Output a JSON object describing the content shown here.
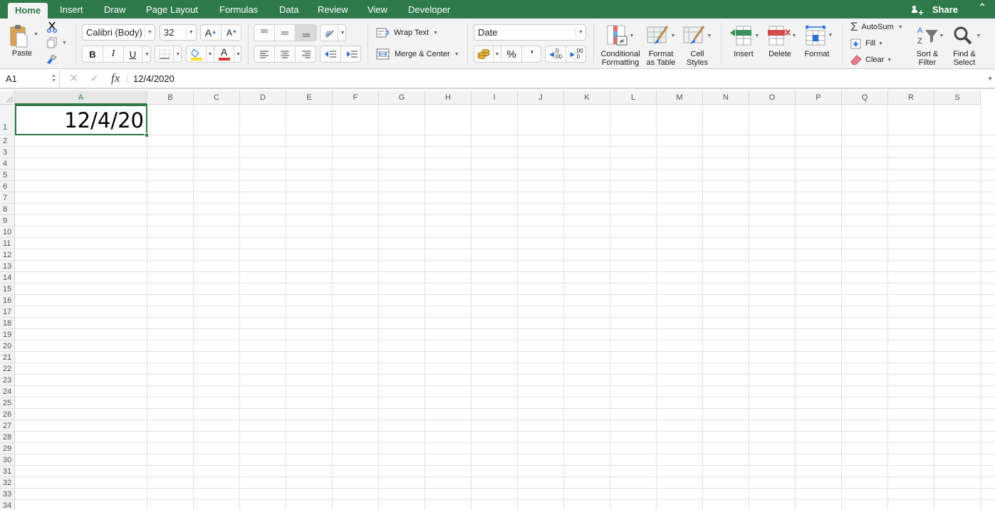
{
  "ribbon_tabs": [
    {
      "label": "Home",
      "active": true
    },
    {
      "label": "Insert"
    },
    {
      "label": "Draw"
    },
    {
      "label": "Page Layout"
    },
    {
      "label": "Formulas"
    },
    {
      "label": "Data"
    },
    {
      "label": "Review"
    },
    {
      "label": "View"
    },
    {
      "label": "Developer"
    }
  ],
  "share_label": "Share",
  "clipboard": {
    "paste_label": "Paste",
    "icons": [
      "clipboard-icon",
      "scissors-icon",
      "copy-icon",
      "format-painter-icon"
    ]
  },
  "font": {
    "name": "Calibri (Body)",
    "size": "32",
    "bold": "B",
    "italic": "I",
    "underline": "U",
    "increase": "A",
    "decrease": "A",
    "font_color_label": "A",
    "fill_color": "#f5e02a",
    "font_color": "#d13b3b"
  },
  "alignment": {
    "wrap_text": "Wrap Text",
    "merge_center": "Merge & Center"
  },
  "number": {
    "format": "Date",
    "percent": "%",
    "comma": "’",
    "inc_decimal_top": ".0",
    "inc_decimal_bottom": ".00",
    "dec_decimal_top": ".00",
    "dec_decimal_bottom": ".0"
  },
  "styles": {
    "conditional_formatting": [
      "Conditional",
      "Formatting"
    ],
    "format_as_table": [
      "Format",
      "as Table"
    ],
    "cell_styles": [
      "Cell",
      "Styles"
    ]
  },
  "cells_group": {
    "insert": "Insert",
    "delete": "Delete",
    "format": "Format"
  },
  "editing": {
    "autosum": "AutoSum",
    "fill": "Fill",
    "clear": "Clear",
    "sort_filter": [
      "Sort &",
      "Filter"
    ],
    "find_select": [
      "Find &",
      "Select"
    ]
  },
  "formula_bar": {
    "name_box": "A1",
    "fx": "fx",
    "content": "12/4/2020"
  },
  "sheet": {
    "columns": [
      "A",
      "B",
      "C",
      "D",
      "E",
      "F",
      "G",
      "H",
      "I",
      "J",
      "K",
      "L",
      "M",
      "N",
      "O",
      "P",
      "Q",
      "R",
      "S"
    ],
    "rows": [
      "1",
      "2",
      "3",
      "4",
      "5",
      "6",
      "7",
      "8",
      "9",
      "10",
      "11",
      "12",
      "13",
      "14",
      "15",
      "16",
      "17",
      "18",
      "19",
      "20",
      "21",
      "22",
      "23",
      "24",
      "25",
      "26",
      "27",
      "28",
      "29",
      "30",
      "31",
      "32",
      "33",
      "34"
    ],
    "selected_cell": "A1",
    "a1_display": "12/4/20"
  },
  "colors": {
    "accent": "#2f7a4a",
    "ribbon_bg": "#f3f3f3"
  }
}
